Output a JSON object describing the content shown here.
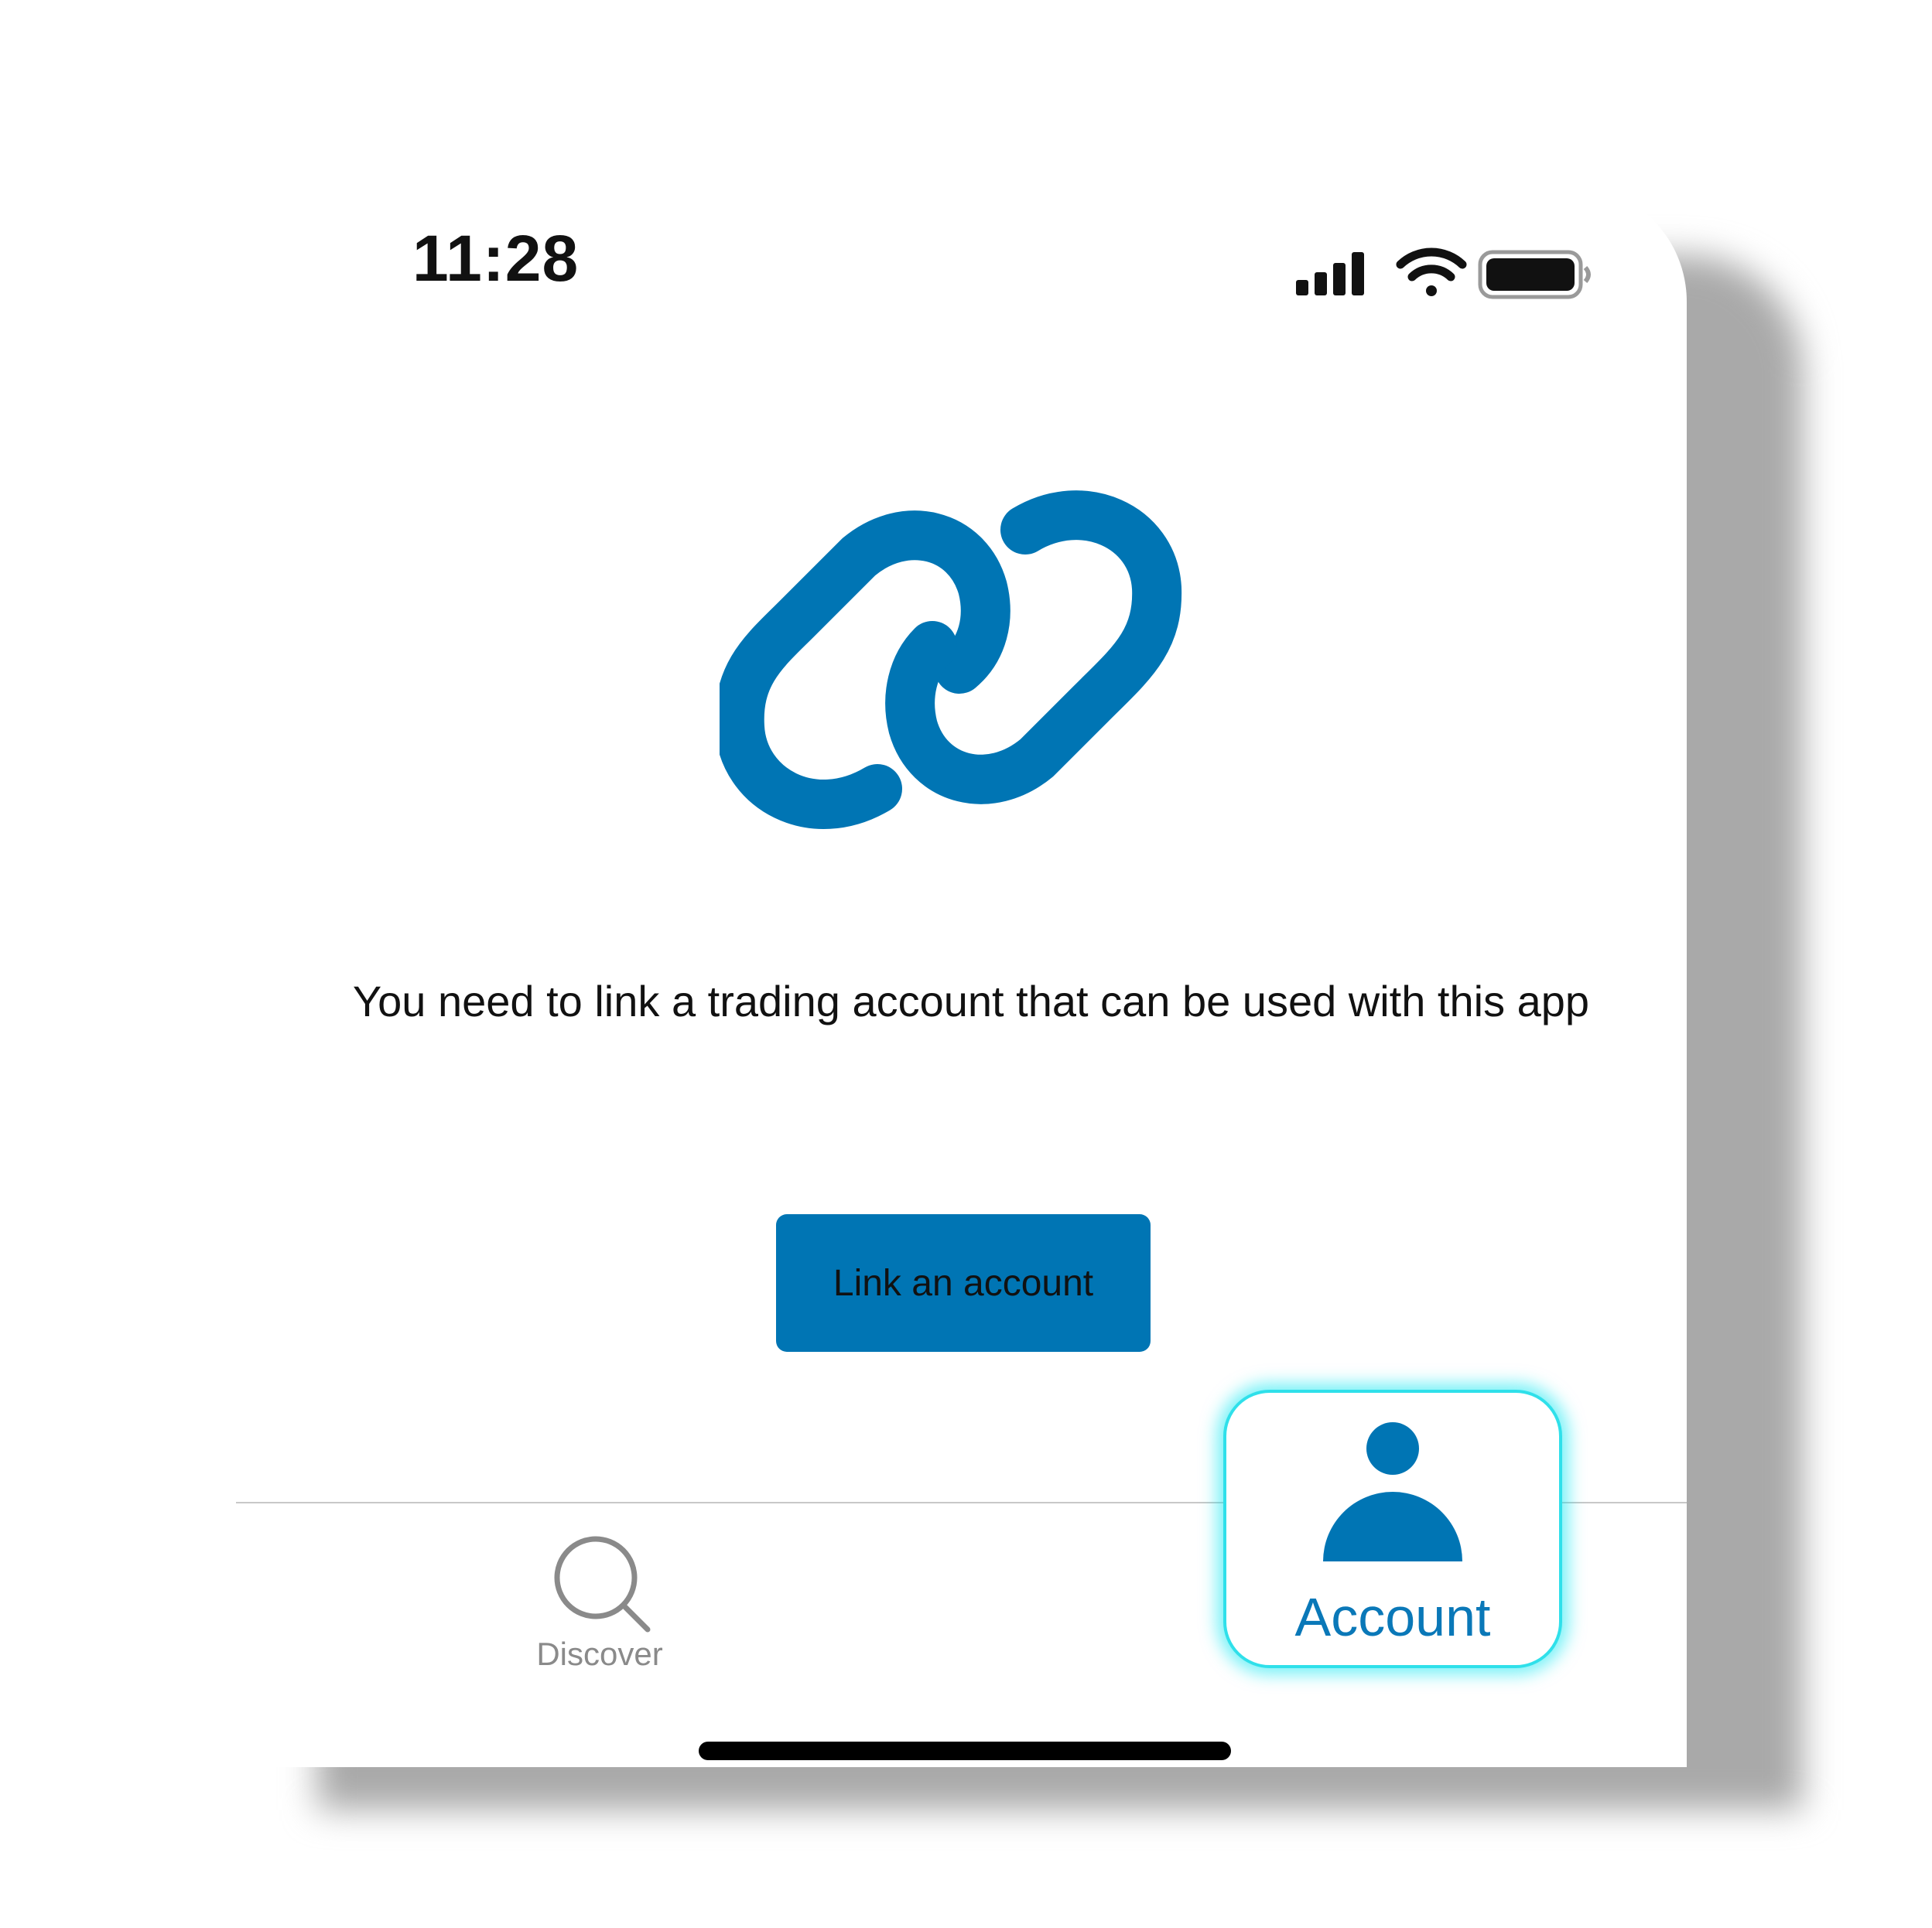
{
  "status_bar": {
    "time": "11:28",
    "icons": [
      "cellular-signal-icon",
      "wifi-icon",
      "battery-icon"
    ]
  },
  "main": {
    "hero_icon": "link-icon",
    "message": "You need to link a trading account that can be used with this app",
    "link_button_label": "Link an account"
  },
  "tab_bar": {
    "tabs": [
      {
        "label": "Discover",
        "icon": "search-icon",
        "selected": false
      },
      {
        "label": "Account",
        "icon": "person-icon",
        "selected": true
      }
    ]
  },
  "colors": {
    "accent": "#0075b4",
    "highlight_glow": "#2fe0ea",
    "inactive_tab": "#8a8a8a",
    "text": "#111111"
  }
}
